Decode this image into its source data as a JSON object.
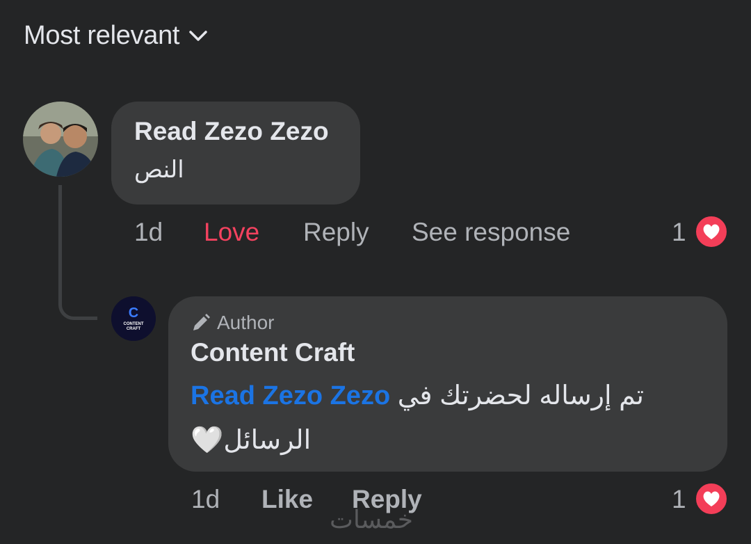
{
  "sort": {
    "label": "Most relevant",
    "icon": "chevron-down-icon"
  },
  "comment": {
    "author": "Read Zezo Zezo",
    "text": "النص",
    "time": "1d",
    "reaction_label": "Love",
    "reply_label": "Reply",
    "see_response_label": "See response",
    "reaction_count": "1",
    "reaction_icon": "heart-icon"
  },
  "reply": {
    "badge": "Author",
    "badge_icon": "pencil-icon",
    "author": "Content Craft",
    "mention": "Read Zezo Zezo",
    "text_line1": "تم إرساله لحضرتك في",
    "text_line2": "الرسائل🤍",
    "time": "1d",
    "like_label": "Like",
    "reply_label": "Reply",
    "reaction_count": "1",
    "reaction_icon": "heart-icon",
    "avatar_letter": "C",
    "avatar_text": "CONTENT CRAFT"
  },
  "watermark": "خمسات",
  "colors": {
    "background": "#242526",
    "bubble": "#3a3b3c",
    "love": "#f3425f",
    "mention": "#1b74e4",
    "heart": "#f33e58"
  }
}
